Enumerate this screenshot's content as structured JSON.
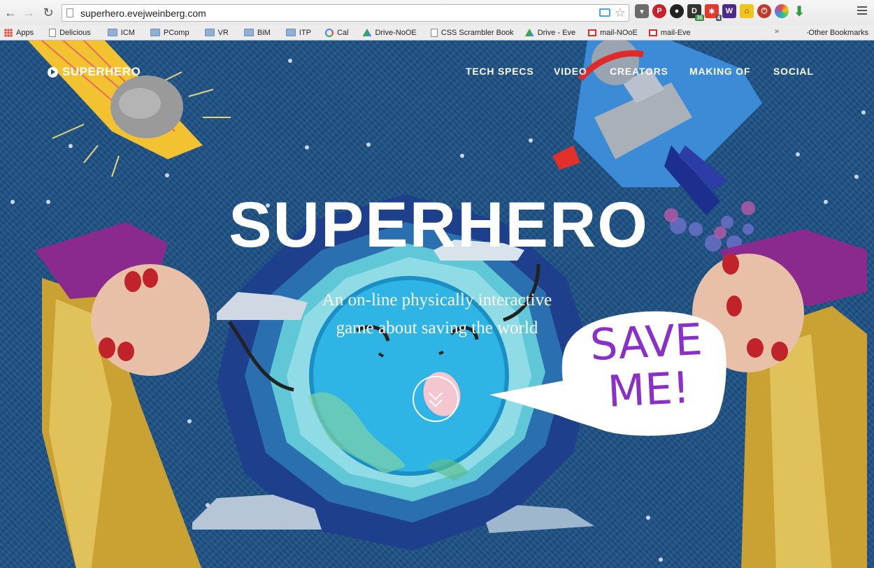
{
  "browser": {
    "url": "superhero.evejweinberg.com",
    "extension_counts": {
      "d": "36",
      "star": "4"
    },
    "bookmarks": [
      {
        "label": "Apps",
        "icon": "apps-icon"
      },
      {
        "label": "Delicious",
        "icon": "doc-icon"
      },
      {
        "label": "ICM",
        "icon": "folder-icon"
      },
      {
        "label": "PComp",
        "icon": "folder-icon"
      },
      {
        "label": "VR",
        "icon": "folder-icon"
      },
      {
        "label": "BiM",
        "icon": "folder-icon"
      },
      {
        "label": "ITP",
        "icon": "folder-icon"
      },
      {
        "label": "Cal",
        "icon": "google-icon"
      },
      {
        "label": "Drive-NoOE",
        "icon": "drive-icon"
      },
      {
        "label": "CSS Scrambler Book",
        "icon": "doc-icon"
      },
      {
        "label": "Drive - Eve",
        "icon": "drive-icon"
      },
      {
        "label": "mail-NOoE",
        "icon": "gmail-icon"
      },
      {
        "label": "mail-Eve",
        "icon": "gmail-icon"
      }
    ],
    "overflow_label": "»",
    "other_bookmarks": "Other Bookmarks"
  },
  "site": {
    "logo_text": "SUPERHERO",
    "nav": [
      "TECH SPECS",
      "VIDEO",
      "CREATORS",
      "MAKING OF",
      "SOCIAL"
    ],
    "hero_title": "SUPERHERO",
    "tagline_line1": "An on-line physically interactive",
    "tagline_line2": "game about saving the world",
    "speech_line1": "SAVE",
    "speech_line2": "ME!"
  },
  "colors": {
    "background": "#1b4f83",
    "globe": "#2fb4e6",
    "speech_text": "#8b2fc9",
    "meteor": "#f2c230",
    "gold_sleeve": "#c9a233",
    "purple_cuff": "#8a2a8f"
  }
}
